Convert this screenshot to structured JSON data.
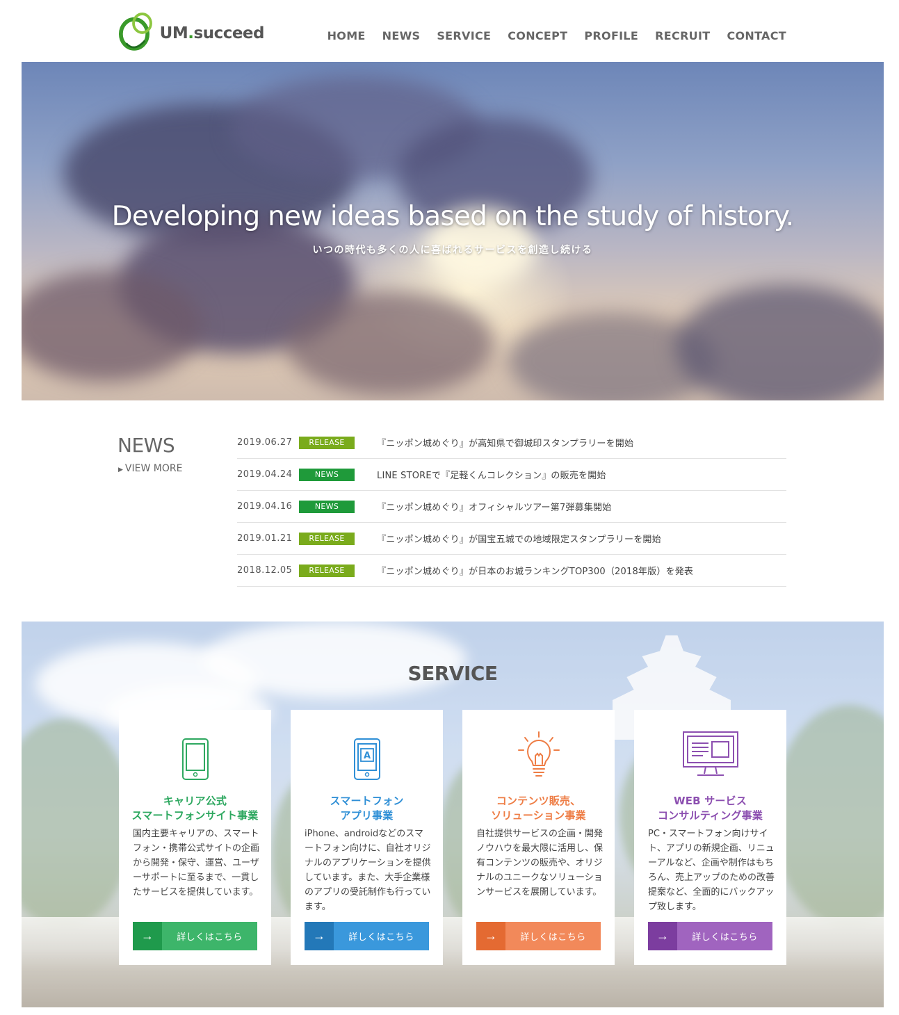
{
  "colors": {
    "logo_green": "#3a9a2a",
    "nav_text": "#666666",
    "release_badge": "#7aab1c",
    "news_badge": "#1f9a3a",
    "card1": "#2ea860",
    "card2": "#2f8fd6",
    "card3": "#ee7d45",
    "card4": "#8c4fb0"
  },
  "header": {
    "logo_main": "UM",
    "logo_dot": ".",
    "logo_sub": "succeed",
    "nav": [
      {
        "label": "HOME"
      },
      {
        "label": "NEWS"
      },
      {
        "label": "SERVICE"
      },
      {
        "label": "CONCEPT"
      },
      {
        "label": "PROFILE"
      },
      {
        "label": "RECRUIT"
      },
      {
        "label": "CONTACT"
      }
    ]
  },
  "hero": {
    "title": "Developing new ideas based on the study of history.",
    "subtitle": "いつの時代も多くの人に喜ばれるサービスを創造し続ける"
  },
  "news": {
    "heading": "NEWS",
    "more_label": "VIEW MORE",
    "more_arrow": "▶",
    "items": [
      {
        "date": "2019.06.27",
        "badge": "RELEASE",
        "text": "『ニッポン城めぐり』が高知県で御城印スタンプラリーを開始"
      },
      {
        "date": "2019.04.24",
        "badge": "NEWS",
        "text": "LINE STOREで『足軽くんコレクション』の販売を開始"
      },
      {
        "date": "2019.04.16",
        "badge": "NEWS",
        "text": "『ニッポン城めぐり』オフィシャルツアー第7弾募集開始"
      },
      {
        "date": "2019.01.21",
        "badge": "RELEASE",
        "text": "『ニッポン城めぐり』が国宝五城での地域限定スタンプラリーを開始"
      },
      {
        "date": "2018.12.05",
        "badge": "RELEASE",
        "text": "『ニッポン城めぐり』が日本のお城ランキングTOP300（2018年版）を発表"
      }
    ]
  },
  "service": {
    "heading": "SERVICE",
    "cards": [
      {
        "icon": "smartphone-icon",
        "title_line1": "キャリア公式",
        "title_line2": "スマートフォンサイト事業",
        "desc": "国内主要キャリアの、スマートフォン・携帯公式サイトの企画から開発・保守、運営、ユーザーサポートに至るまで、一貫したサービスを提供しています。",
        "button": "詳しくはこちら"
      },
      {
        "icon": "smartphone-app-icon",
        "icon_letter": "A",
        "title_line1": "スマートフォン",
        "title_line2": "アプリ事業",
        "desc": "iPhone、androidなどのスマートフォン向けに、自社オリジナルのアプリケーションを提供しています。また、大手企業様のアプリの受託制作も行っています。",
        "button": "詳しくはこちら"
      },
      {
        "icon": "lightbulb-icon",
        "title_line1": "コンテンツ販売、",
        "title_line2": "ソリューション事業",
        "desc": "自社提供サービスの企画・開発ノウハウを最大限に活用し、保有コンテンツの販売や、オリジナルのユニークなソリューションサービスを展開しています。",
        "button": "詳しくはこちら"
      },
      {
        "icon": "monitor-icon",
        "title_line1": "WEB サービス",
        "title_line2": "コンサルティング事業",
        "desc": "PC・スマートフォン向けサイト、アプリの新規企画、リニューアルなど、企画や制作はもちろん、売上アップのための改善提案など、全面的にバックアップ致します。",
        "button": "詳しくはこちら"
      }
    ]
  }
}
